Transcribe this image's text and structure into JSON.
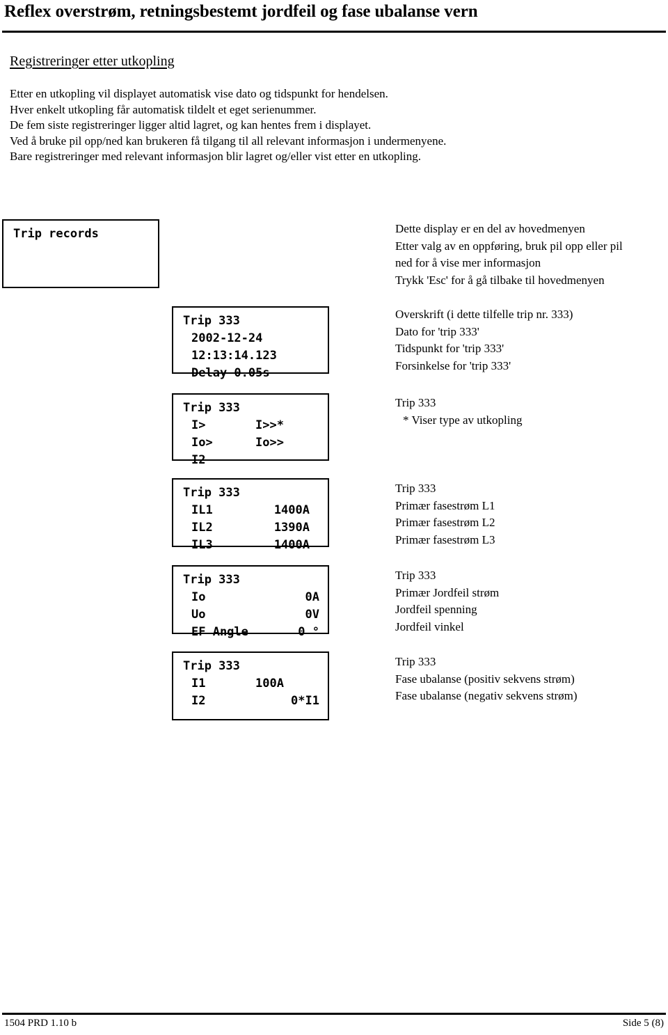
{
  "document": {
    "title": "Reflex overstrøm, retningsbestemt jordfeil og fase ubalanse vern",
    "section_heading": "Registreringer etter utkopling",
    "intro_lines": [
      "Etter en utkopling vil displayet automatisk vise dato og tidspunkt for hendelsen.",
      "Hver enkelt utkopling får automatisk tildelt et eget serienummer.",
      "De fem siste registreringer ligger altid lagret, og kan hentes frem i displayet.",
      "Ved å bruke pil opp/ned kan brukeren få tilgang til all relevant informasjon i undermenyene.",
      "Bare registreringer med relevant informasjon blir lagret og/eller vist etter en utkopling."
    ]
  },
  "displays": {
    "records": {
      "rows": [
        {
          "label": "Trip records",
          "value": ""
        },
        {
          "label": "",
          "value": ""
        },
        {
          "label": "",
          "value": ""
        }
      ],
      "notes": [
        "Dette display er en del av hovedmenyen",
        "Etter valg av en oppføring, bruk pil opp eller pil",
        "ned for å vise mer informasjon",
        "Trykk 'Esc' for å gå tilbake til hovedmenyen"
      ]
    },
    "datetime": {
      "rows": [
        {
          "label": "Trip 333",
          "value": ""
        },
        {
          "label": "2002-12-24",
          "value": ""
        },
        {
          "label": "12:13:14.123",
          "value": ""
        },
        {
          "label": "Delay 0.05s",
          "value": ""
        }
      ],
      "notes": [
        "Overskrift (i dette tilfelle trip nr. 333)",
        "Dato for 'trip 333'",
        "Tidspunkt for 'trip 333'",
        "Forsinkelse for 'trip 333'"
      ]
    },
    "triptype": {
      "rows": [
        {
          "label": "Trip 333",
          "value": ""
        },
        {
          "label": "I>",
          "value": "I>>*"
        },
        {
          "label": "Io>",
          "value": "Io>>"
        },
        {
          "label": "I2",
          "value": ""
        }
      ],
      "notes": [
        "Trip 333",
        "* Viser type av utkopling"
      ]
    },
    "phasecurrents": {
      "rows": [
        {
          "label": "Trip 333",
          "value": ""
        },
        {
          "label": "IL1",
          "value": "1400A"
        },
        {
          "label": "IL2",
          "value": "1390A"
        },
        {
          "label": "IL3",
          "value": "1400A"
        }
      ],
      "notes": [
        "Trip 333",
        "Primær fasestrøm L1",
        "Primær fasestrøm L2",
        "Primær fasestrøm L3"
      ]
    },
    "earthfault": {
      "rows": [
        {
          "label": "Trip 333",
          "value": ""
        },
        {
          "label": "Io",
          "value": "0A"
        },
        {
          "label": "Uo",
          "value": "0V"
        },
        {
          "label": "EF Angle",
          "value": "0 °"
        }
      ],
      "notes": [
        "Trip 333",
        "Primær Jordfeil strøm",
        "Jordfeil spenning",
        "Jordfeil vinkel"
      ]
    },
    "sequence": {
      "rows": [
        {
          "label": "Trip 333",
          "value": ""
        },
        {
          "label": "I1",
          "value": "100A"
        },
        {
          "label": "I2",
          "value": "0*I1"
        },
        {
          "label": "",
          "value": ""
        }
      ],
      "notes": [
        "Trip 333",
        "Fase ubalanse (positiv sekvens strøm)",
        "Fase ubalanse (negativ sekvens strøm)"
      ]
    }
  },
  "footer": {
    "left": "1504 PRD 1.10 b",
    "right": "Side 5 (8)"
  },
  "colors": {
    "text": "#000000",
    "background": "#ffffff",
    "rule": "#000000"
  }
}
